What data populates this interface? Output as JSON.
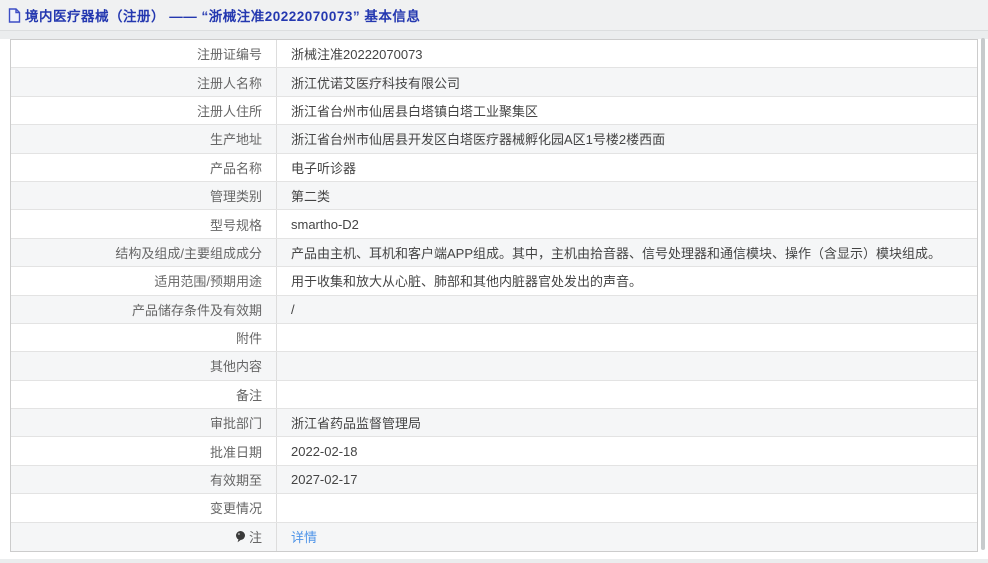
{
  "page": {
    "title": "境内医疗器械（注册） —— “浙械注准20222070073” 基本信息",
    "colors": {
      "title_blue": "#2438b0",
      "link_blue": "#4f94e8",
      "row_alt_bg": "#f5f6f7"
    },
    "icons": {
      "header": "document-icon",
      "note_row": "note-balloon-icon"
    }
  },
  "table": {
    "rows": [
      {
        "label": "注册证编号",
        "value": "浙械注准20222070073"
      },
      {
        "label": "注册人名称",
        "value": "浙江优诺艾医疗科技有限公司"
      },
      {
        "label": "注册人住所",
        "value": "浙江省台州市仙居县白塔镇白塔工业聚集区"
      },
      {
        "label": "生产地址",
        "value": "浙江省台州市仙居县开发区白塔医疗器械孵化园A区1号楼2楼西面"
      },
      {
        "label": "产品名称",
        "value": "电子听诊器"
      },
      {
        "label": "管理类别",
        "value": "第二类"
      },
      {
        "label": "型号规格",
        "value": "smartho-D2"
      },
      {
        "label": "结构及组成/主要组成成分",
        "value": "产品由主机、耳机和客户端APP组成。其中，主机由拾音器、信号处理器和通信模块、操作（含显示）模块组成。"
      },
      {
        "label": "适用范围/预期用途",
        "value": "用于收集和放大从心脏、肺部和其他内脏器官处发出的声音。"
      },
      {
        "label": "产品储存条件及有效期",
        "value": "/"
      },
      {
        "label": "附件",
        "value": ""
      },
      {
        "label": "其他内容",
        "value": ""
      },
      {
        "label": "备注",
        "value": ""
      },
      {
        "label": "审批部门",
        "value": "浙江省药品监督管理局"
      },
      {
        "label": "批准日期",
        "value": "2022-02-18"
      },
      {
        "label": "有效期至",
        "value": "2027-02-17"
      },
      {
        "label": "变更情况",
        "value": ""
      },
      {
        "label": "注",
        "value": "详情",
        "value_is_link": true
      }
    ]
  }
}
